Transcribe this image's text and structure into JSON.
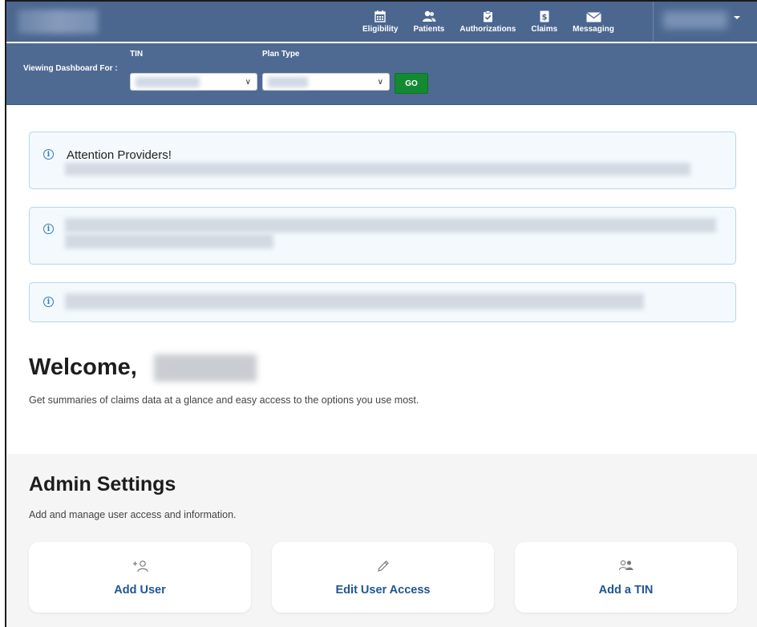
{
  "nav": {
    "items": [
      {
        "label": "Eligibility",
        "icon": "calendar-icon"
      },
      {
        "label": "Patients",
        "icon": "people-icon"
      },
      {
        "label": "Authorizations",
        "icon": "clipboard-check-icon"
      },
      {
        "label": "Claims",
        "icon": "dollar-document-icon"
      },
      {
        "label": "Messaging",
        "icon": "envelope-icon"
      }
    ]
  },
  "filters": {
    "caption": "Viewing Dashboard For :",
    "tin_label": "TIN",
    "plan_type_label": "Plan Type",
    "go_label": "GO"
  },
  "notices": [
    {
      "title": "Attention Providers!"
    },
    {
      "title": ""
    },
    {
      "title": ""
    }
  ],
  "welcome": {
    "greeting": "Welcome,",
    "subtitle": "Get summaries of claims data at a glance and easy access to the options you use most."
  },
  "admin": {
    "title": "Admin Settings",
    "subtitle": "Add and manage user access and information.",
    "cards": [
      {
        "label": "Add User",
        "icon": "add-user-icon"
      },
      {
        "label": "Edit User Access",
        "icon": "pencil-icon"
      },
      {
        "label": "Add a TIN",
        "icon": "users-icon"
      }
    ]
  },
  "colors": {
    "header_bg": "#4b6790",
    "go_button": "#138a32",
    "notice_border": "#b5d7ec",
    "info_icon": "#2f78b9",
    "card_label": "#1f5592"
  }
}
